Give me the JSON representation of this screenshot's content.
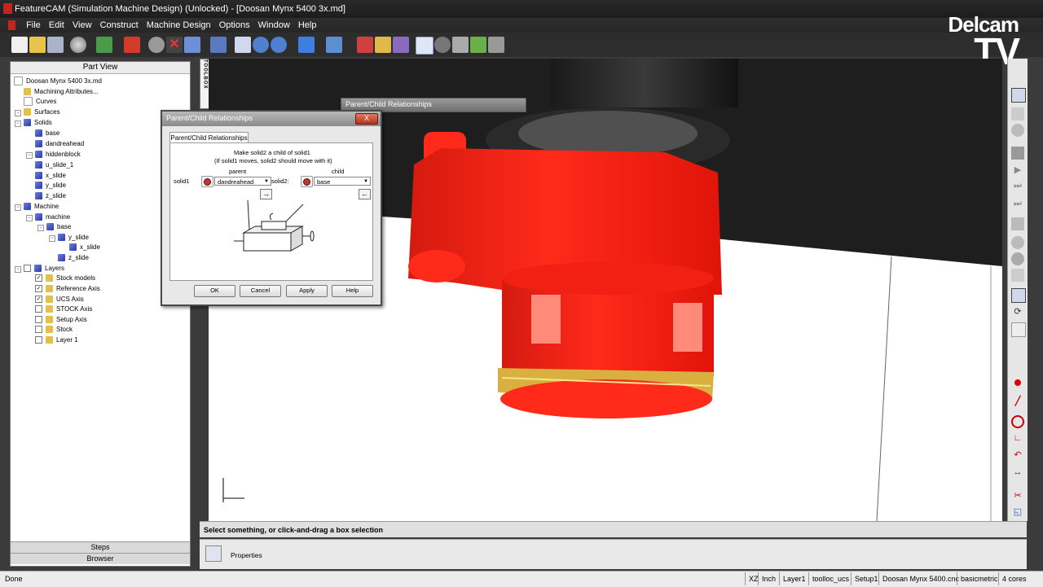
{
  "window": {
    "title": "FeatureCAM (Simulation Machine Design) (Unlocked) - [Doosan Mynx 5400 3x.md]"
  },
  "menu": [
    "File",
    "Edit",
    "View",
    "Construct",
    "Machine Design",
    "Options",
    "Window",
    "Help"
  ],
  "logo": {
    "line1": "Delcam",
    "line2": "TV"
  },
  "part_view": {
    "header": "Part View",
    "items": [
      {
        "label": "Doosan Mynx 5400 3x.md",
        "icon": "document-icon"
      },
      {
        "label": "Machining Attributes...",
        "icon": "attributes-icon"
      },
      {
        "label": "Curves",
        "icon": "curve-icon"
      },
      {
        "label": "Surfaces",
        "icon": "surface-icon"
      },
      {
        "label": "Solids",
        "icon": "cube-icon"
      },
      {
        "label": "base",
        "icon": "cube-icon"
      },
      {
        "label": "dandreahead",
        "icon": "cube-icon"
      },
      {
        "label": "hiddenblock",
        "icon": "cube-icon"
      },
      {
        "label": "u_slide_1",
        "icon": "cube-icon"
      },
      {
        "label": "x_slide",
        "icon": "cube-icon"
      },
      {
        "label": "y_slide",
        "icon": "cube-icon"
      },
      {
        "label": "z_slide",
        "icon": "cube-icon"
      },
      {
        "label": "Machine",
        "icon": "cube-icon"
      },
      {
        "label": "machine",
        "icon": "cube-icon"
      },
      {
        "label": "base",
        "icon": "cube-icon"
      },
      {
        "label": "y_slide",
        "icon": "cube-icon"
      },
      {
        "label": "x_slide",
        "icon": "cube-icon"
      },
      {
        "label": "z_slide",
        "icon": "cube-icon"
      },
      {
        "label": "Layers",
        "icon": "layers-icon"
      },
      {
        "label": "Stock models",
        "icon": "layer-icon"
      },
      {
        "label": "Reference Axis",
        "icon": "layer-icon"
      },
      {
        "label": "UCS Axis",
        "icon": "layer-icon"
      },
      {
        "label": "STOCK Axis",
        "icon": "layer-icon"
      },
      {
        "label": "Setup Axis",
        "icon": "layer-icon"
      },
      {
        "label": "Stock",
        "icon": "layer-icon"
      },
      {
        "label": "Layer 1",
        "icon": "layer-icon"
      }
    ]
  },
  "bottom_tabs": {
    "steps": "Steps",
    "browser": "Browser"
  },
  "toolbox_label": "TOOLBOX",
  "dialog_behind": {
    "title": "Parent/Child Relationships"
  },
  "dialog": {
    "title": "Parent/Child Relationships",
    "close": "X",
    "tab": "Parent/Child Relationships",
    "instruction1": "Make solid2 a child of solid1",
    "instruction2": "(If solid1 moves, solid2 should move with it)",
    "parent_label": "parent",
    "child_label": "child",
    "solid1_label": "solid1",
    "solid2_label": "solid2:",
    "solid1_value": "dandreahead",
    "solid2_value": "base",
    "buttons": {
      "ok": "OK",
      "cancel": "Cancel",
      "apply": "Apply",
      "help": "Help"
    }
  },
  "status_message": "Select something, or click-and-drag a box selection",
  "properties_label": "Properties",
  "statusbar": {
    "left": "Done",
    "cells": [
      "XZ",
      "Inch",
      "Layer1",
      "toolloc_ucs",
      "Setup1",
      "Doosan Mynx 5400.cnc",
      "basicmetric",
      "4 cores"
    ]
  },
  "colors": {
    "accent_red": "#ff2a1a",
    "dark_ui": "#2d2d2d"
  }
}
